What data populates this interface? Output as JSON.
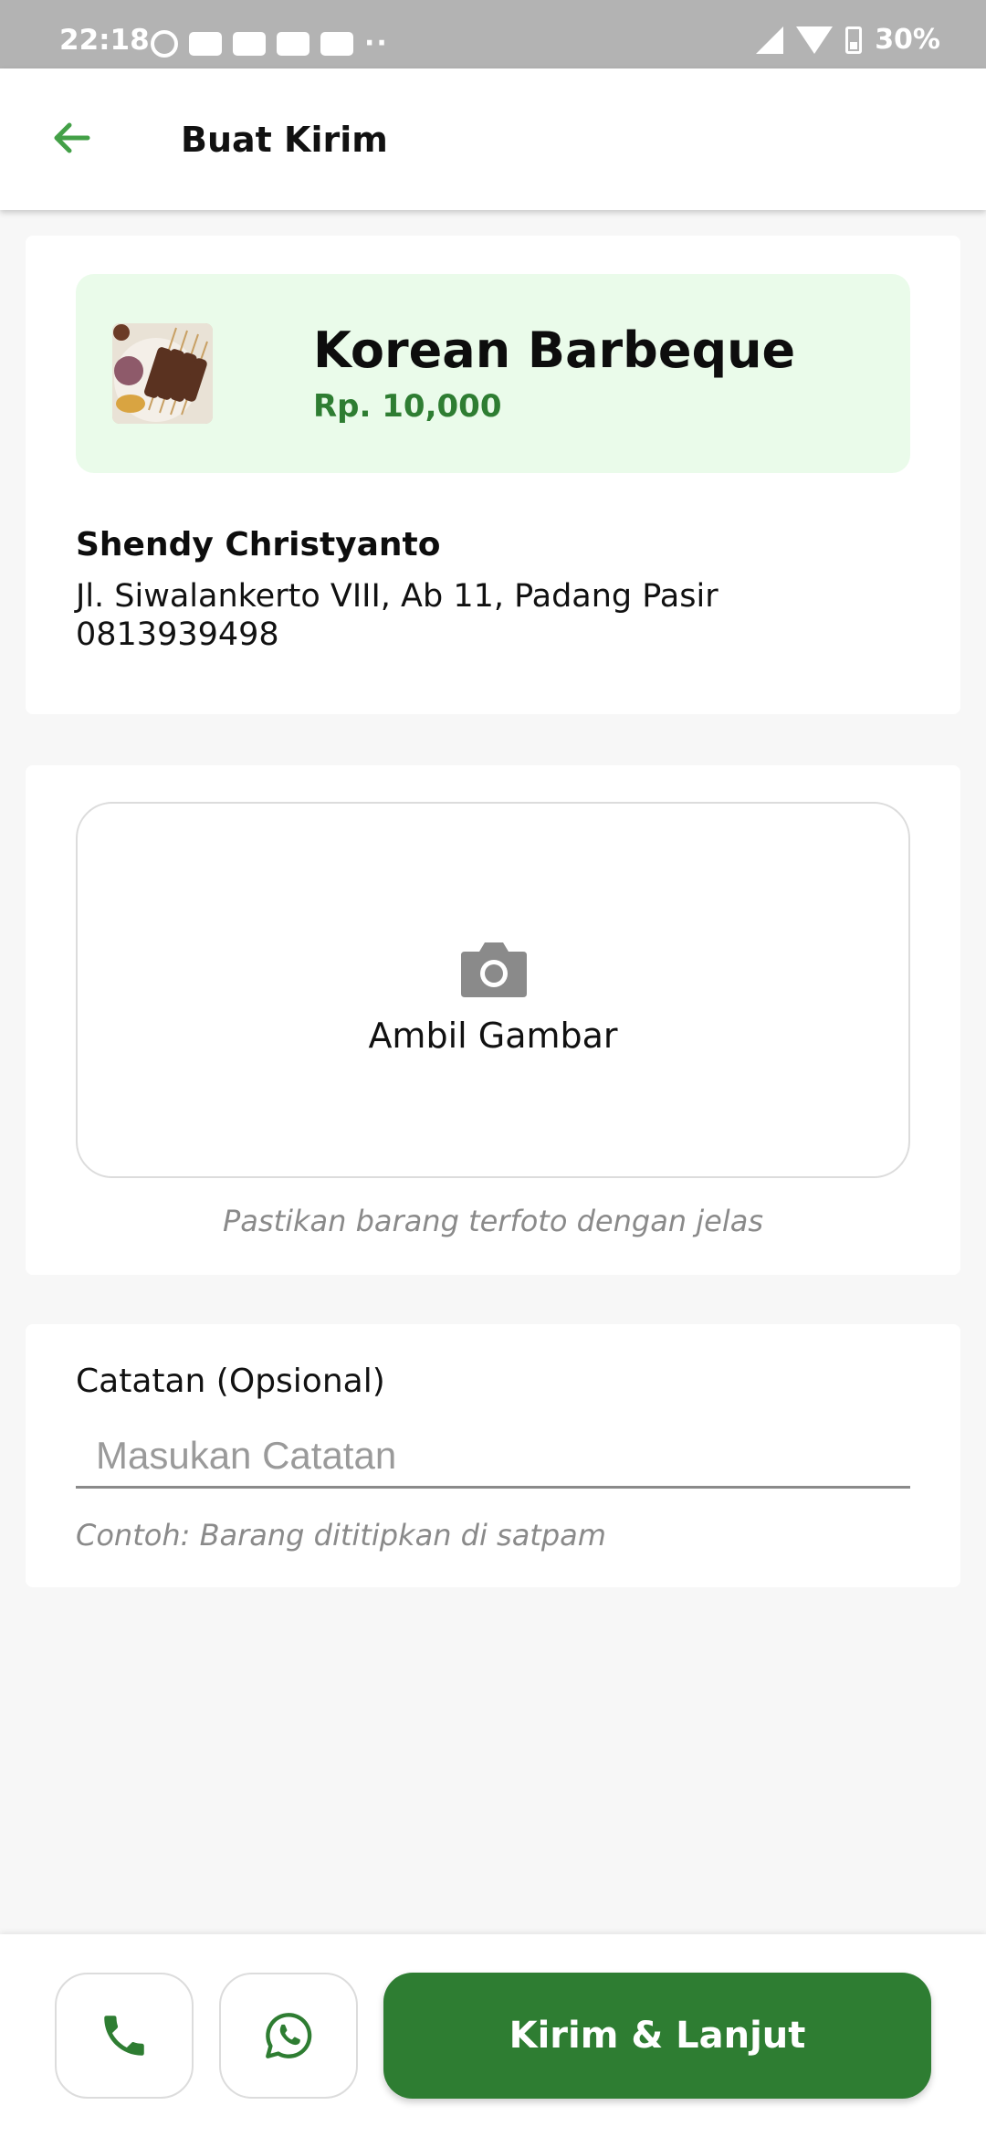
{
  "status_bar": {
    "time": "22:18",
    "battery": "30%",
    "icons": [
      "alarm-icon",
      "youtube-icon",
      "gmail-icon",
      "news-icon",
      "youtube-icon",
      "more-dots-icon",
      "signal-icon",
      "wifi-icon",
      "battery-icon"
    ]
  },
  "header": {
    "title": "Buat Kirim",
    "back_icon": "arrow-left-icon"
  },
  "product": {
    "name": "Korean Barbeque",
    "price": "Rp. 10,000"
  },
  "recipient": {
    "name": "Shendy Christyanto",
    "address": "Jl. Siwalankerto VIII, Ab 11, Padang Pasir",
    "phone": "0813939498"
  },
  "photo": {
    "label": "Ambil Gambar",
    "hint": "Pastikan barang terfoto dengan jelas",
    "icon": "camera-icon"
  },
  "notes": {
    "label": "Catatan (Opsional)",
    "placeholder": "Masukan Catatan",
    "value": "",
    "hint": "Contoh: Barang dititipkan di satpam"
  },
  "actions": {
    "submit_label": "Kirim & Lanjut",
    "call_icon": "phone-icon",
    "whatsapp_icon": "whatsapp-icon"
  },
  "colors": {
    "primary": "#2e7d32",
    "back_arrow": "#43a047",
    "product_bg": "#eafbea",
    "status_bar": "#b3b3b3"
  }
}
